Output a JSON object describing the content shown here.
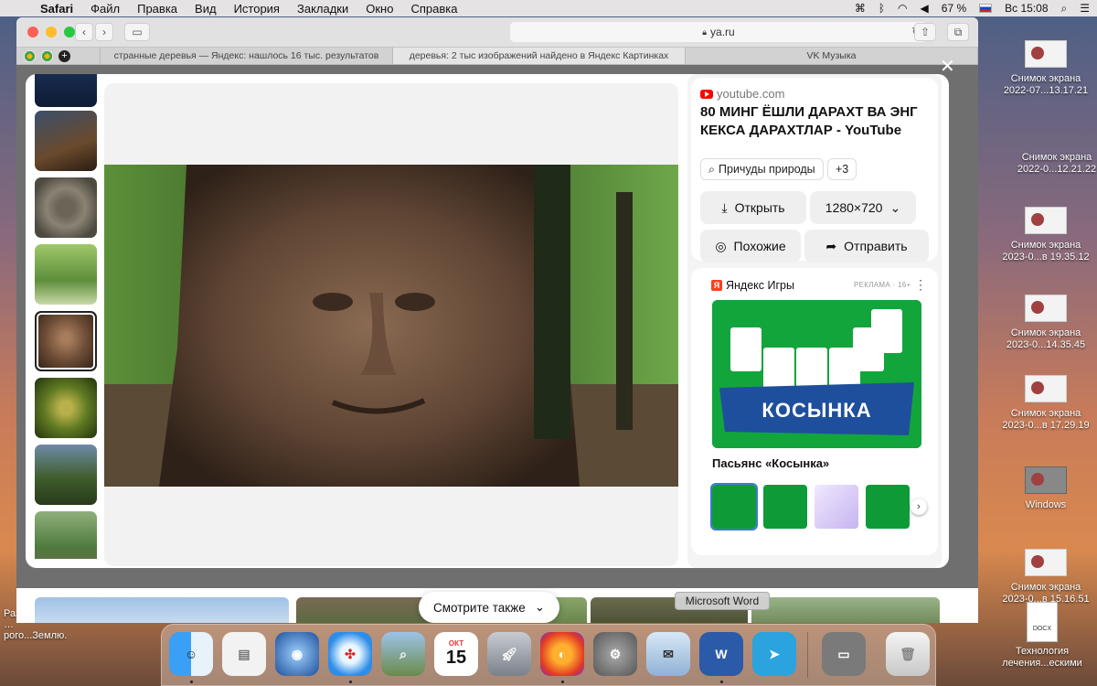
{
  "menubar": {
    "app": "Safari",
    "items": [
      "Файл",
      "Правка",
      "Вид",
      "История",
      "Закладки",
      "Окно",
      "Справка"
    ],
    "battery": "67 %",
    "clock": "Вс 15:08"
  },
  "browser": {
    "url": "ya.ru",
    "tabs": [
      "странные деревья — Яндекс: нашлось 16 тыс. результатов",
      "деревья: 2 тыс изображений найдено в Яндекс Картинках",
      "VK Музыка"
    ]
  },
  "viewer": {
    "source": "youtube.com",
    "title": "80 МИНГ ЁШЛИ ДАРАХТ ВА ЭНГ КЕКСА ДАРАХТЛАР - YouTube",
    "tag": "Причуды природы",
    "tag_more": "+3",
    "open_label": "Открыть",
    "size_label": "1280×720",
    "similar_label": "Похожие",
    "share_label": "Отправить",
    "ad_brand": "Яндекс Игры",
    "ad_tag": "РЕКЛАМА · 16+",
    "ad_banner_text": "КОСЫНКА",
    "ad_game_name": "Пасьянс «Косынка»",
    "see_also": "Смотрите также"
  },
  "dock": {
    "tooltip": "Microsoft Word",
    "calendar_month": "ОКТ",
    "calendar_day": "15"
  },
  "desktop": {
    "right_items": [
      "Снимок экрана\n2022-07...13.17.21",
      "Снимок экрана\n2022-0...12.21.22",
      "Снимок экрана\n2023-0...в 19.35.12",
      "Снимок экрана\n2023-0...14.35.45",
      "Снимок экрана\n2023-0...в 17.29.19",
      "Windows",
      "Снимок экрана\n2023-0...в 15.16.51",
      "Технология\nлечения...ескими"
    ],
    "left_label": "Разрушение\n…рого...Землю."
  },
  "colors": {
    "accent": "#fc3f1d",
    "youtube": "#ff0000"
  }
}
